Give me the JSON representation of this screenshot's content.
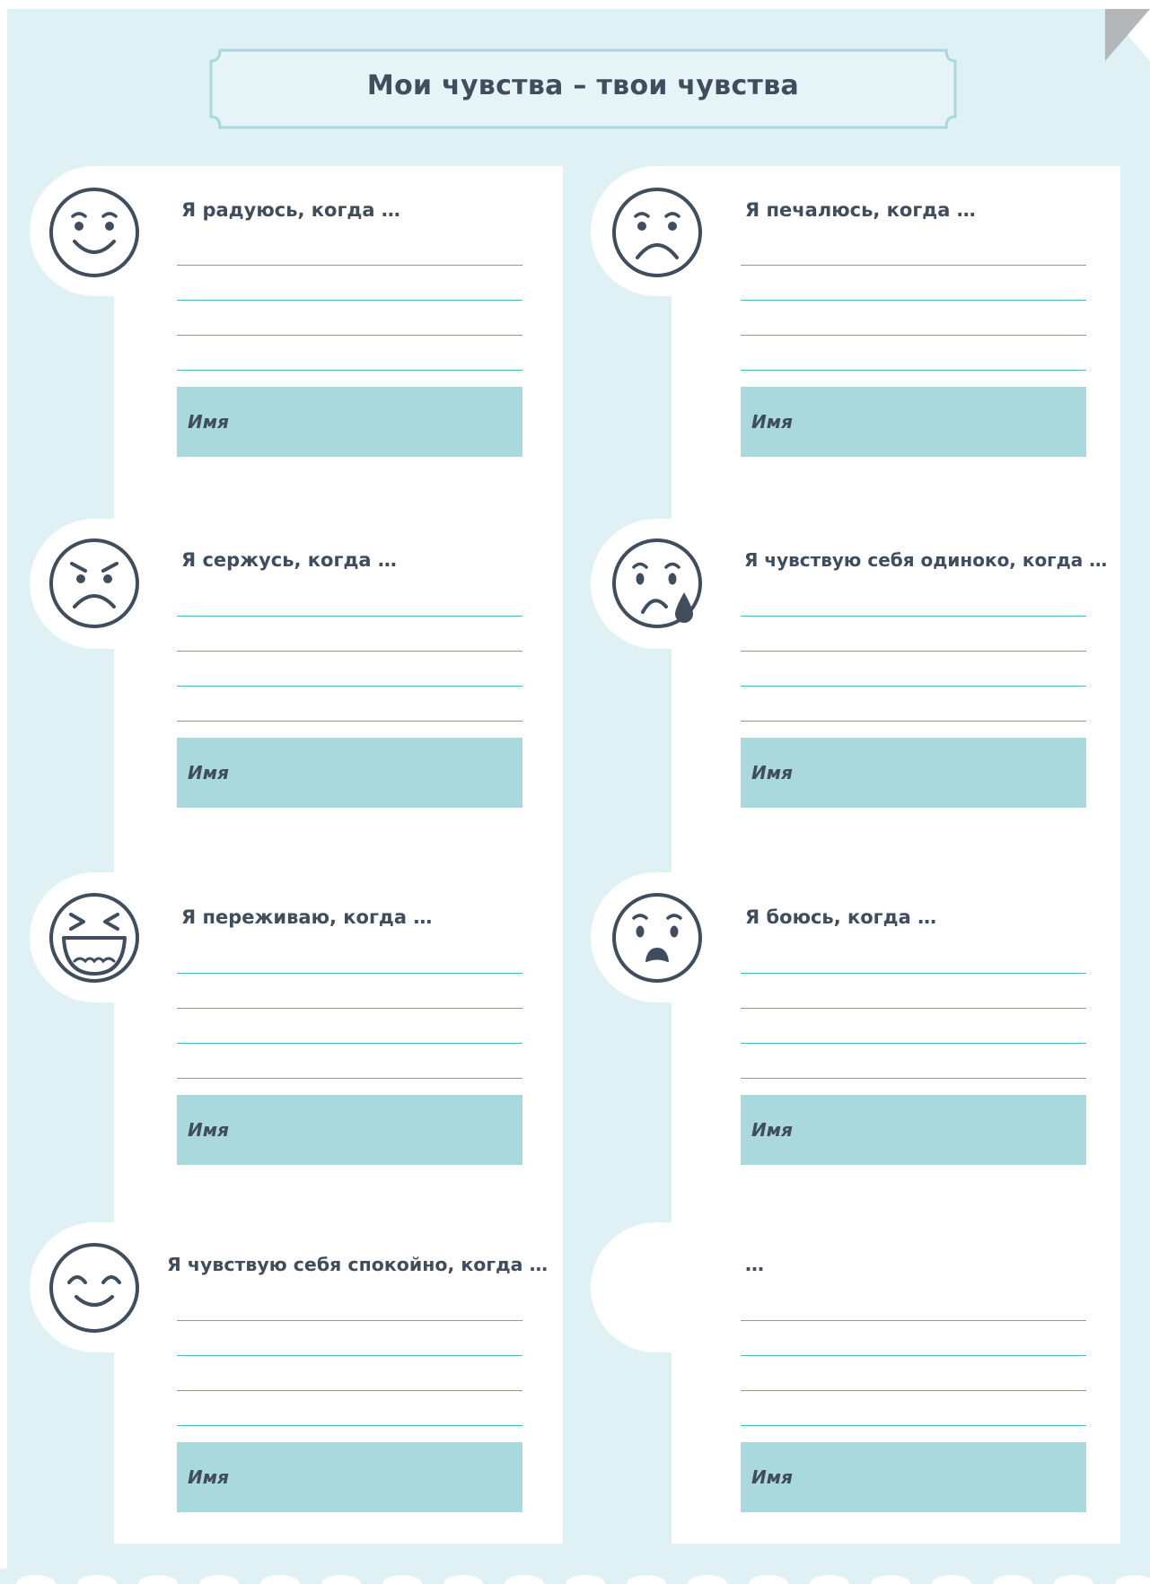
{
  "title": "Мои чувства – твои чувства",
  "cards": [
    {
      "prompt": "Я радуюсь, когда …",
      "name_label": "Имя",
      "emoji": "happy-face-icon"
    },
    {
      "prompt": "Я печалюсь, когда …",
      "name_label": "Имя",
      "emoji": "sad-face-icon"
    },
    {
      "prompt": "Я сержусь, когда …",
      "name_label": "Имя",
      "emoji": "angry-face-icon"
    },
    {
      "prompt": "Я чувствую себя одиноко, когда …",
      "name_label": "Имя",
      "emoji": "crying-face-icon"
    },
    {
      "prompt": "Я переживаю, когда …",
      "name_label": "Имя",
      "emoji": "laughing-face-icon"
    },
    {
      "prompt": "Я боюсь, когда …",
      "name_label": "Имя",
      "emoji": "scared-face-icon"
    },
    {
      "prompt": "Я чувствую себя спокойно, когда …",
      "name_label": "Имя",
      "emoji": "calm-face-icon"
    },
    {
      "prompt": "…",
      "name_label": "Имя",
      "emoji": ""
    }
  ],
  "colors": {
    "background": "#e0f1f5",
    "card": "#ffffff",
    "line": "#46b9b8",
    "name_box": "#a9d8dd",
    "text": "#3f4d5d"
  }
}
